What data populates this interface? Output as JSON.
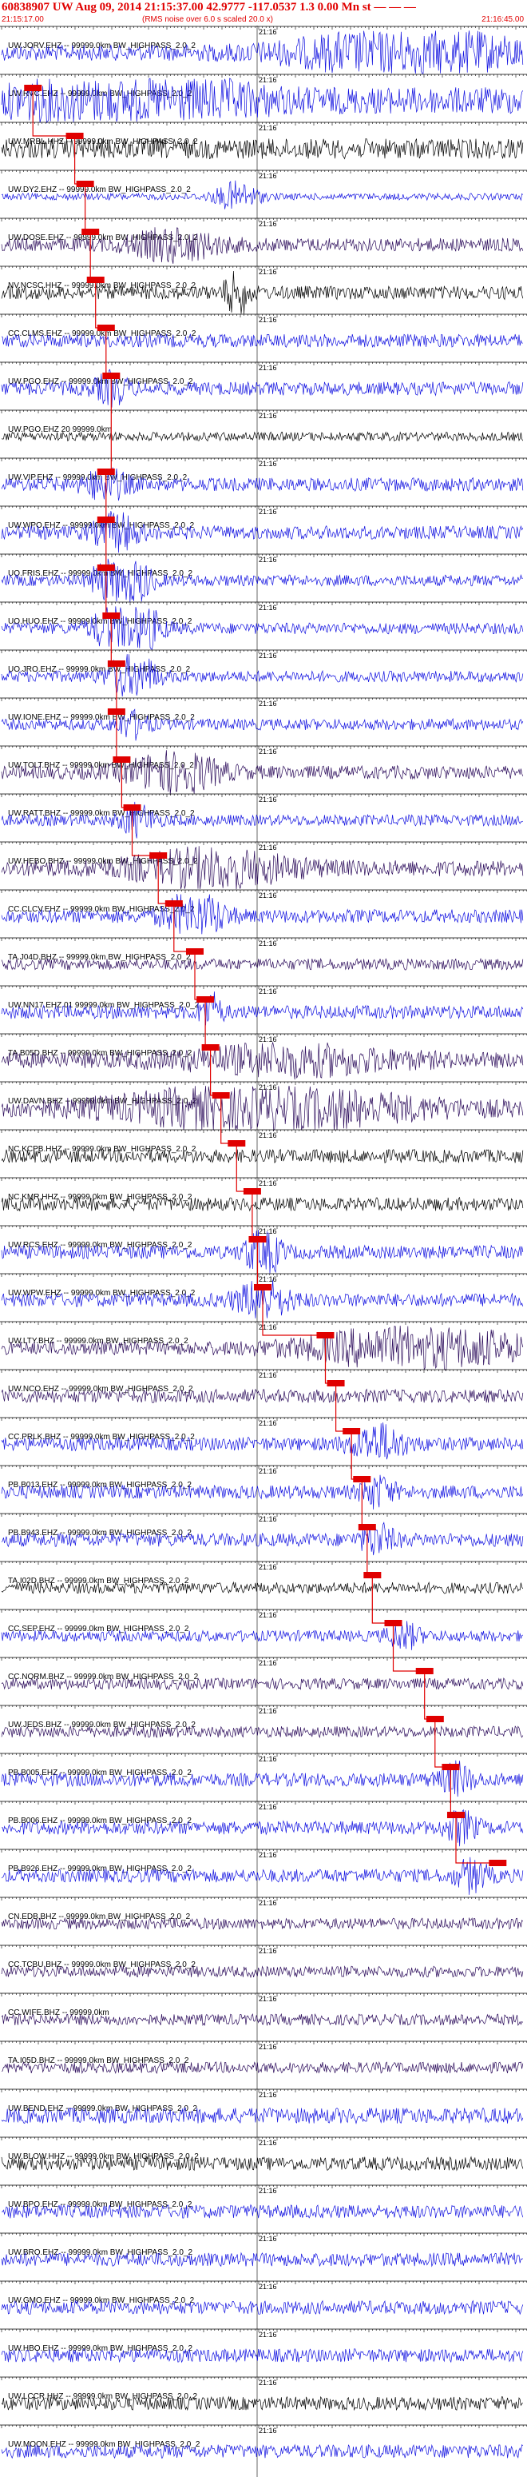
{
  "header": {
    "title": "60838907 UW Aug 09, 2014 21:15:37.00   42.9777 -117.0537  1.3 0.00 Mn st — — — ",
    "start_time": "21:15:17.00",
    "noise_note": "(RMS noise over 6.0 s scaled 20.0 x)",
    "end_time": "21:16:45.00"
  },
  "minute_label": "21:16",
  "colors": {
    "blue": "#1010e0",
    "black": "#000000",
    "purple": "#2a0a5a",
    "pick": "#e00000"
  },
  "traces": [
    {
      "label": "UW.JORV.EHZ -- 99999.0km BW_HIGHPASS_2.0_2",
      "color": "blue",
      "amp": 0.35,
      "bursts": [
        [
          0.78,
          0.22,
          2.6
        ]
      ],
      "pick": null
    },
    {
      "label": "UW.RVC.EHZ -- 99999.0km BW_HIGHPASS_2.0_2",
      "color": "blue",
      "amp": 0.6,
      "bursts": [
        [
          0.25,
          0.18,
          2.2
        ]
      ],
      "pick": 0.06
    },
    {
      "label": "UW.MRBL.HHZ -- 99999.0km BW_HIGHPASS_2.0_2",
      "color": "black",
      "amp": 0.45,
      "bursts": [],
      "pick": 0.14
    },
    {
      "label": "UW.DY2.EHZ -- 99999.0km BW_HIGHPASS_2.0_2",
      "color": "blue",
      "amp": 0.15,
      "bursts": [
        [
          0.45,
          0.04,
          4
        ]
      ],
      "pick": 0.16
    },
    {
      "label": "UW.DOSE.EHZ -- 99999.0km BW_HIGHPASS_2.0_2",
      "color": "purple",
      "amp": 0.3,
      "bursts": [
        [
          0.33,
          0.08,
          2
        ]
      ],
      "pick": 0.17
    },
    {
      "label": "NV.NCSC.HHZ -- 99999.0km BW_HIGHPASS_2.0_2",
      "color": "black",
      "amp": 0.3,
      "bursts": [
        [
          0.45,
          0.02,
          4
        ]
      ],
      "pick": 0.18
    },
    {
      "label": "CC.CLMS.EHZ -- 99999.0km BW_HIGHPASS_2.0_2",
      "color": "blue",
      "amp": 0.3,
      "bursts": [],
      "pick": 0.2
    },
    {
      "label": "UW.PGO.EHZ -- 99999.0km BW_HIGHPASS_2.0_2",
      "color": "blue",
      "amp": 0.3,
      "bursts": [
        [
          0.21,
          0.03,
          2
        ]
      ],
      "pick": 0.21
    },
    {
      "label": "UW.PGO.EHZ 20 99999.0km",
      "color": "black",
      "amp": 0.2,
      "bursts": [],
      "pick": null
    },
    {
      "label": "UW.VIP.EHZ -- 99999.0km BW_HIGHPASS_2.0_2",
      "color": "blue",
      "amp": 0.3,
      "bursts": [
        [
          0.2,
          0.04,
          2
        ]
      ],
      "pick": 0.2
    },
    {
      "label": "UW.WPO.EHZ -- 99999.0km BW_HIGHPASS_2.0_2",
      "color": "blue",
      "amp": 0.3,
      "bursts": [
        [
          0.22,
          0.04,
          2.5
        ]
      ],
      "pick": 0.2
    },
    {
      "label": "UO.FRIS.EHZ -- 99999.0km BW_HIGHPASS_2.0_2",
      "color": "blue",
      "amp": 0.25,
      "bursts": [
        [
          0.23,
          0.04,
          10
        ]
      ],
      "pick": 0.2
    },
    {
      "label": "UO.HUO.EHZ -- 99999.0km BW_HIGHPASS_2.0_2",
      "color": "blue",
      "amp": 0.25,
      "bursts": [
        [
          0.24,
          0.05,
          8
        ]
      ],
      "pick": 0.21
    },
    {
      "label": "UO.JRO.EHZ -- 99999.0km BW_HIGHPASS_2.0_2",
      "color": "blue",
      "amp": 0.25,
      "bursts": [
        [
          0.25,
          0.04,
          5
        ]
      ],
      "pick": 0.22
    },
    {
      "label": "UW.IONE.EHZ -- 99999.0km BW_HIGHPASS_2.0_2",
      "color": "blue",
      "amp": 0.25,
      "bursts": [
        [
          0.25,
          0.03,
          2
        ]
      ],
      "pick": 0.22
    },
    {
      "label": "UW.TOLT.BHZ -- 99999.0km BW_HIGHPASS_2.0_2",
      "color": "purple",
      "amp": 0.3,
      "bursts": [
        [
          0.33,
          0.08,
          3
        ]
      ],
      "pick": 0.23
    },
    {
      "label": "UW.RATT.BHZ -- 99999.0km BW_HIGHPASS_2.0_2",
      "color": "blue",
      "amp": 0.25,
      "bursts": [
        [
          0.26,
          0.03,
          2.5
        ]
      ],
      "pick": 0.25
    },
    {
      "label": "UW.HEBO.BHZ -- 99999.0km BW_HIGHPASS_2.0_2",
      "color": "purple",
      "amp": 0.35,
      "bursts": [
        [
          0.4,
          0.15,
          2
        ]
      ],
      "pick": 0.3
    },
    {
      "label": "CC.CLCV.EHZ -- 99999.0km BW_HIGHPASS_2.0_2",
      "color": "blue",
      "amp": 0.3,
      "bursts": [
        [
          0.37,
          0.05,
          4
        ]
      ],
      "pick": 0.33
    },
    {
      "label": "TA.J04D.BHZ -- 99999.0km BW_HIGHPASS_2.0_2",
      "color": "purple",
      "amp": 0.25,
      "bursts": [],
      "pick": 0.37
    },
    {
      "label": "UW.NN17.EHZ 01 99999.0km BW_HIGHPASS_2.0_2",
      "color": "blue",
      "amp": 0.3,
      "bursts": [
        [
          0.4,
          0.02,
          2.5
        ]
      ],
      "pick": 0.39
    },
    {
      "label": "TA.B05D.BHZ -- 99999.0km BW_HIGHPASS_2.0_2",
      "color": "purple",
      "amp": 0.35,
      "bursts": [
        [
          0.55,
          0.2,
          1.5
        ]
      ],
      "pick": 0.4
    },
    {
      "label": "UW.DAVN.BHZ -- 99999.0km BW_HIGHPASS_2.0_2",
      "color": "purple",
      "amp": 0.4,
      "bursts": [
        [
          0.5,
          0.25,
          2.2
        ]
      ],
      "pick": 0.42
    },
    {
      "label": "NC.KCPB.HHZ -- 99999.0km BW_HIGHPASS_2.0_2",
      "color": "black",
      "amp": 0.3,
      "bursts": [],
      "pick": 0.45
    },
    {
      "label": "NC.KMR.HHZ -- 99999.0km BW_HIGHPASS_2.0_2",
      "color": "black",
      "amp": 0.3,
      "bursts": [],
      "pick": 0.48
    },
    {
      "label": "UW.RCS.EHZ -- 99999.0km BW_HIGHPASS_2.0_2",
      "color": "blue",
      "amp": 0.3,
      "bursts": [
        [
          0.5,
          0.03,
          4
        ]
      ],
      "pick": 0.49
    },
    {
      "label": "UW.WPW.EHZ -- 99999.0km BW_HIGHPASS_2.0_2",
      "color": "blue",
      "amp": 0.3,
      "bursts": [
        [
          0.5,
          0.05,
          2.5
        ]
      ],
      "pick": 0.5
    },
    {
      "label": "UW.LTY.BHZ -- 99999.0km BW_HIGHPASS_2.0_2",
      "color": "purple",
      "amp": 0.3,
      "bursts": [
        [
          0.8,
          0.2,
          3
        ]
      ],
      "pick": 0.62
    },
    {
      "label": "UW.NCO.EHZ -- 99999.0km BW_HIGHPASS_2.0_2",
      "color": "purple",
      "amp": 0.3,
      "bursts": [],
      "pick": 0.64
    },
    {
      "label": "CC.PRLK.BHZ -- 99999.0km BW_HIGHPASS_2.0_2",
      "color": "blue",
      "amp": 0.3,
      "bursts": [
        [
          0.72,
          0.05,
          2.5
        ]
      ],
      "pick": 0.67
    },
    {
      "label": "PB.B013.EHZ -- 99999.0km BW_HIGHPASS_2.0_2",
      "color": "blue",
      "amp": 0.3,
      "bursts": [
        [
          0.72,
          0.03,
          2
        ]
      ],
      "pick": 0.69
    },
    {
      "label": "PB.B943.EHZ -- 99999.0km BW_HIGHPASS_2.0_2",
      "color": "blue",
      "amp": 0.3,
      "bursts": [
        [
          0.72,
          0.03,
          2
        ]
      ],
      "pick": 0.7
    },
    {
      "label": "TA.I02D.BHZ -- 99999.0km BW_HIGHPASS_2.0_2",
      "color": "black",
      "amp": 0.25,
      "bursts": [],
      "pick": 0.71
    },
    {
      "label": "CC.SEP.EHZ -- 99999.0km BW_HIGHPASS_2.0_2",
      "color": "blue",
      "amp": 0.25,
      "bursts": [
        [
          0.77,
          0.03,
          2
        ]
      ],
      "pick": 0.75
    },
    {
      "label": "CC.NORM.BHZ -- 99999.0km BW_HIGHPASS_2.0_2",
      "color": "purple",
      "amp": 0.25,
      "bursts": [],
      "pick": 0.81
    },
    {
      "label": "UW.JEDS.BHZ -- 99999.0km BW_HIGHPASS_2.0_2",
      "color": "purple",
      "amp": 0.25,
      "bursts": [],
      "pick": 0.83
    },
    {
      "label": "PB.B005.EHZ -- 99999.0km BW_HIGHPASS_2.0_2",
      "color": "blue",
      "amp": 0.3,
      "bursts": [
        [
          0.87,
          0.03,
          2
        ]
      ],
      "pick": 0.86
    },
    {
      "label": "PB.B006.EHZ -- 99999.0km BW_HIGHPASS_2.0_2",
      "color": "blue",
      "amp": 0.3,
      "bursts": [
        [
          0.88,
          0.03,
          2
        ]
      ],
      "pick": 0.87
    },
    {
      "label": "PB.B926.EHZ -- 99999.0km BW_HIGHPASS_2.0_2",
      "color": "blue",
      "amp": 0.3,
      "bursts": [
        [
          0.9,
          0.03,
          2
        ]
      ],
      "pick": 0.95
    },
    {
      "label": "CN.EDB.BHZ -- 99999.0km BW_HIGHPASS_2.0_2",
      "color": "purple",
      "amp": 0.25,
      "bursts": [],
      "pick": null
    },
    {
      "label": "CC.TCBU.BHZ -- 99999.0km BW_HIGHPASS_2.0_2",
      "color": "purple",
      "amp": 0.25,
      "bursts": [],
      "pick": null
    },
    {
      "label": "CC.WIFE.BHZ -- 99999.0km",
      "color": "purple",
      "amp": 0.25,
      "bursts": [],
      "pick": null
    },
    {
      "label": "TA.I05D.BHZ -- 99999.0km BW_HIGHPASS_2.0_2",
      "color": "purple",
      "amp": 0.25,
      "bursts": [],
      "pick": null
    },
    {
      "label": "UW.BEND.EHZ -- 99999.0km BW_HIGHPASS_2.0_2",
      "color": "blue",
      "amp": 0.35,
      "bursts": [],
      "pick": null
    },
    {
      "label": "UW.BLOW.HHZ -- 99999.0km BW_HIGHPASS_2.0_2",
      "color": "black",
      "amp": 0.3,
      "bursts": [],
      "pick": null
    },
    {
      "label": "UW.BPO.EHZ -- 99999.0km BW_HIGHPASS_2.0_2",
      "color": "blue",
      "amp": 0.3,
      "bursts": [],
      "pick": null
    },
    {
      "label": "UW.BRO.EHZ -- 99999.0km BW_HIGHPASS_2.0_2",
      "color": "blue",
      "amp": 0.3,
      "bursts": [],
      "pick": null
    },
    {
      "label": "UW.GMO.EHZ -- 99999.0km BW_HIGHPASS_2.0_2",
      "color": "blue",
      "amp": 0.3,
      "bursts": [],
      "pick": null
    },
    {
      "label": "UW.HBO.EHZ -- 99999.0km BW_HIGHPASS_2.0_2",
      "color": "blue",
      "amp": 0.3,
      "bursts": [],
      "pick": null
    },
    {
      "label": "UW.LCCR.HHZ -- 99999.0km BW_HIGHPASS_2.0_2",
      "color": "black",
      "amp": 0.3,
      "bursts": [],
      "pick": null
    },
    {
      "label": "UW.MOON.EHZ -- 99999.0km BW_HIGHPASS_2.0_2",
      "color": "blue",
      "amp": 0.3,
      "bursts": [],
      "pick": null
    }
  ]
}
